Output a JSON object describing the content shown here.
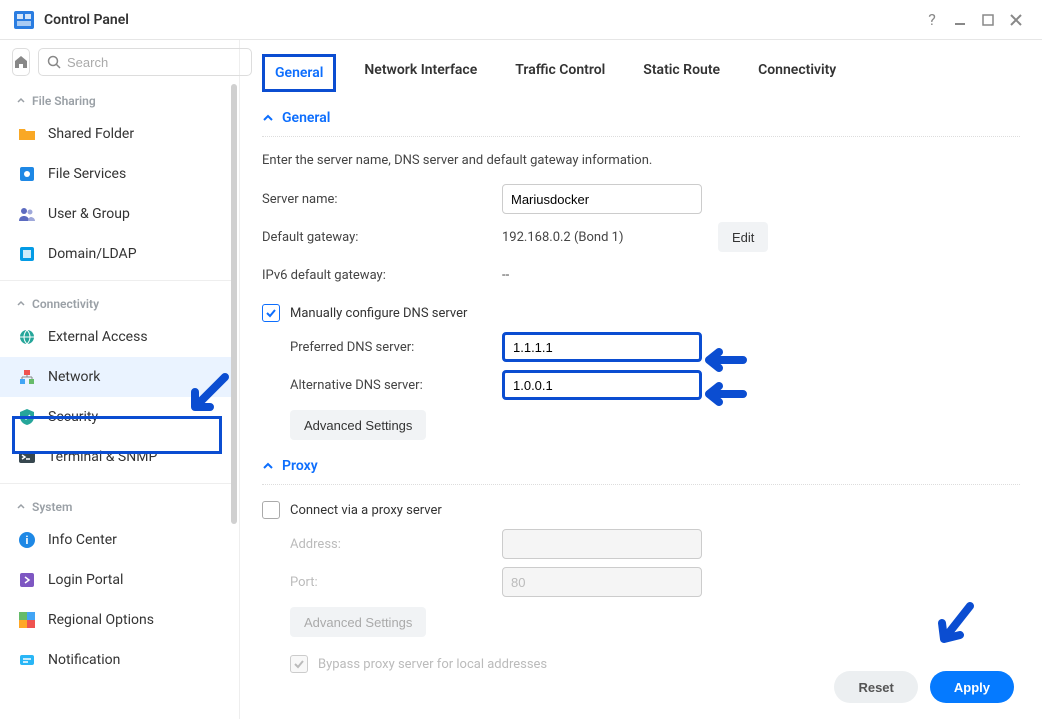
{
  "title": "Control Panel",
  "search": {
    "placeholder": "Search"
  },
  "sidebar": {
    "sections": [
      {
        "label": "File Sharing"
      },
      {
        "label": "Connectivity"
      },
      {
        "label": "System"
      }
    ],
    "items": [
      {
        "label": "Shared Folder"
      },
      {
        "label": "File Services"
      },
      {
        "label": "User & Group"
      },
      {
        "label": "Domain/LDAP"
      },
      {
        "label": "External Access"
      },
      {
        "label": "Network"
      },
      {
        "label": "Security"
      },
      {
        "label": "Terminal & SNMP"
      },
      {
        "label": "Info Center"
      },
      {
        "label": "Login Portal"
      },
      {
        "label": "Regional Options"
      },
      {
        "label": "Notification"
      }
    ]
  },
  "tabs": [
    {
      "label": "General"
    },
    {
      "label": "Network Interface"
    },
    {
      "label": "Traffic Control"
    },
    {
      "label": "Static Route"
    },
    {
      "label": "Connectivity"
    }
  ],
  "general": {
    "heading": "General",
    "desc": "Enter the server name, DNS server and default gateway information.",
    "server_name_label": "Server name:",
    "server_name_value": "Mariusdocker",
    "gateway_label": "Default gateway:",
    "gateway_value": "192.168.0.2 (Bond 1)",
    "edit_label": "Edit",
    "ipv6_label": "IPv6 default gateway:",
    "ipv6_value": "--",
    "manual_dns_label": "Manually configure DNS server",
    "pref_dns_label": "Preferred DNS server:",
    "pref_dns_value": "1.1.1.1",
    "alt_dns_label": "Alternative DNS server:",
    "alt_dns_value": "1.0.0.1",
    "adv_label": "Advanced Settings"
  },
  "proxy": {
    "heading": "Proxy",
    "connect_label": "Connect via a proxy server",
    "address_label": "Address:",
    "port_label": "Port:",
    "port_value": "80",
    "adv_label": "Advanced Settings",
    "bypass_label": "Bypass proxy server for local addresses"
  },
  "footer": {
    "reset": "Reset",
    "apply": "Apply"
  }
}
